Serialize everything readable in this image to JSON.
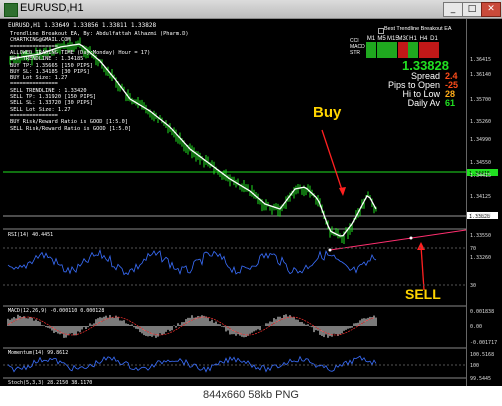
{
  "window": {
    "title": "EURUSD,H1"
  },
  "chart": {
    "header": "EURUSD,H1  1.33649 1.33856 1.33811 1.33828",
    "ea_title": "Best Trendline Breakout EA",
    "info_lines": [
      "Trendline Breakout EA, By: Abdulfattah Alhazmi (Pharm.D)",
      "CHARTKING@GMAIL.COM",
      "===============",
      "ALLOWED TRADING TIME (Day:Monday) Hour = 17)",
      "BUY TRENDLINE : 1.34185",
      "BUY TP: 1.35665 [150 PIPS]",
      "BUY SL: 1.34185 [30 PIPS]",
      "BUY Lot Size: 1.27",
      "===============",
      "SELL TRENDLINE : 1.33420",
      "SELL TP: 1.31920 [150 PIPS]",
      "SELL SL: 1.33720 [30 PIPS]",
      "SELL Lot Size: 1.27",
      "===============",
      "BUY Risk/Reward Ratio is GOOD [1:5.0]",
      "SELL Risk/Reward Ratio is GOOD [1:5.0]"
    ],
    "timeframes": [
      "M1",
      "M5",
      "M15",
      "M30",
      "H1",
      "H4",
      "D1"
    ],
    "side_labels": [
      "CCI",
      "MACD",
      "STR"
    ],
    "current_price": "1.33828",
    "stats": [
      {
        "label": "Spread",
        "value": "2.4",
        "color": "#ff4d1a"
      },
      {
        "label": "Pips to Open",
        "value": "-25",
        "color": "#ff4d1a"
      },
      {
        "label": "Hi to Low",
        "value": "28",
        "color": "#ffae1a"
      },
      {
        "label": "Daily Av",
        "value": "61",
        "color": "#21e021"
      }
    ],
    "annotations": {
      "buy": "Buy",
      "sell": "SELL"
    },
    "price_ticks": [
      "1.36415",
      "1.36140",
      "1.35700",
      "1.35260",
      "1.34990",
      "1.34550",
      "1.34415",
      "1.34125",
      "1.33828",
      "1.33550",
      "1.33260"
    ],
    "buy_tag": "1.34415",
    "current_tag": "1.33828",
    "rsi": {
      "label": "RSI(14) 40.4451",
      "ticks": [
        "70",
        "30"
      ]
    },
    "macd": {
      "label": "MACD(12,26,9) -0.000110 0.000128",
      "ticks": [
        "0.001838",
        "0.00",
        "-0.001717"
      ]
    },
    "momentum": {
      "label": "Momentum(14) 99.8612",
      "ticks": [
        "100.5168",
        "100",
        "99.5445"
      ]
    },
    "stoch": {
      "label": "Stoch(5,3,3) 28.2150 38.1170"
    },
    "colors": {
      "candles": "#21e021",
      "ma": "#ffffff",
      "buyline": "#21e021",
      "sellline": "#ff2f6f",
      "buyarrow": "#ff2020",
      "sellarrow": "#ff2020",
      "indicator": "#3a6fff"
    }
  },
  "statusbar": {
    "text": "844x660  58kb  PNG"
  }
}
